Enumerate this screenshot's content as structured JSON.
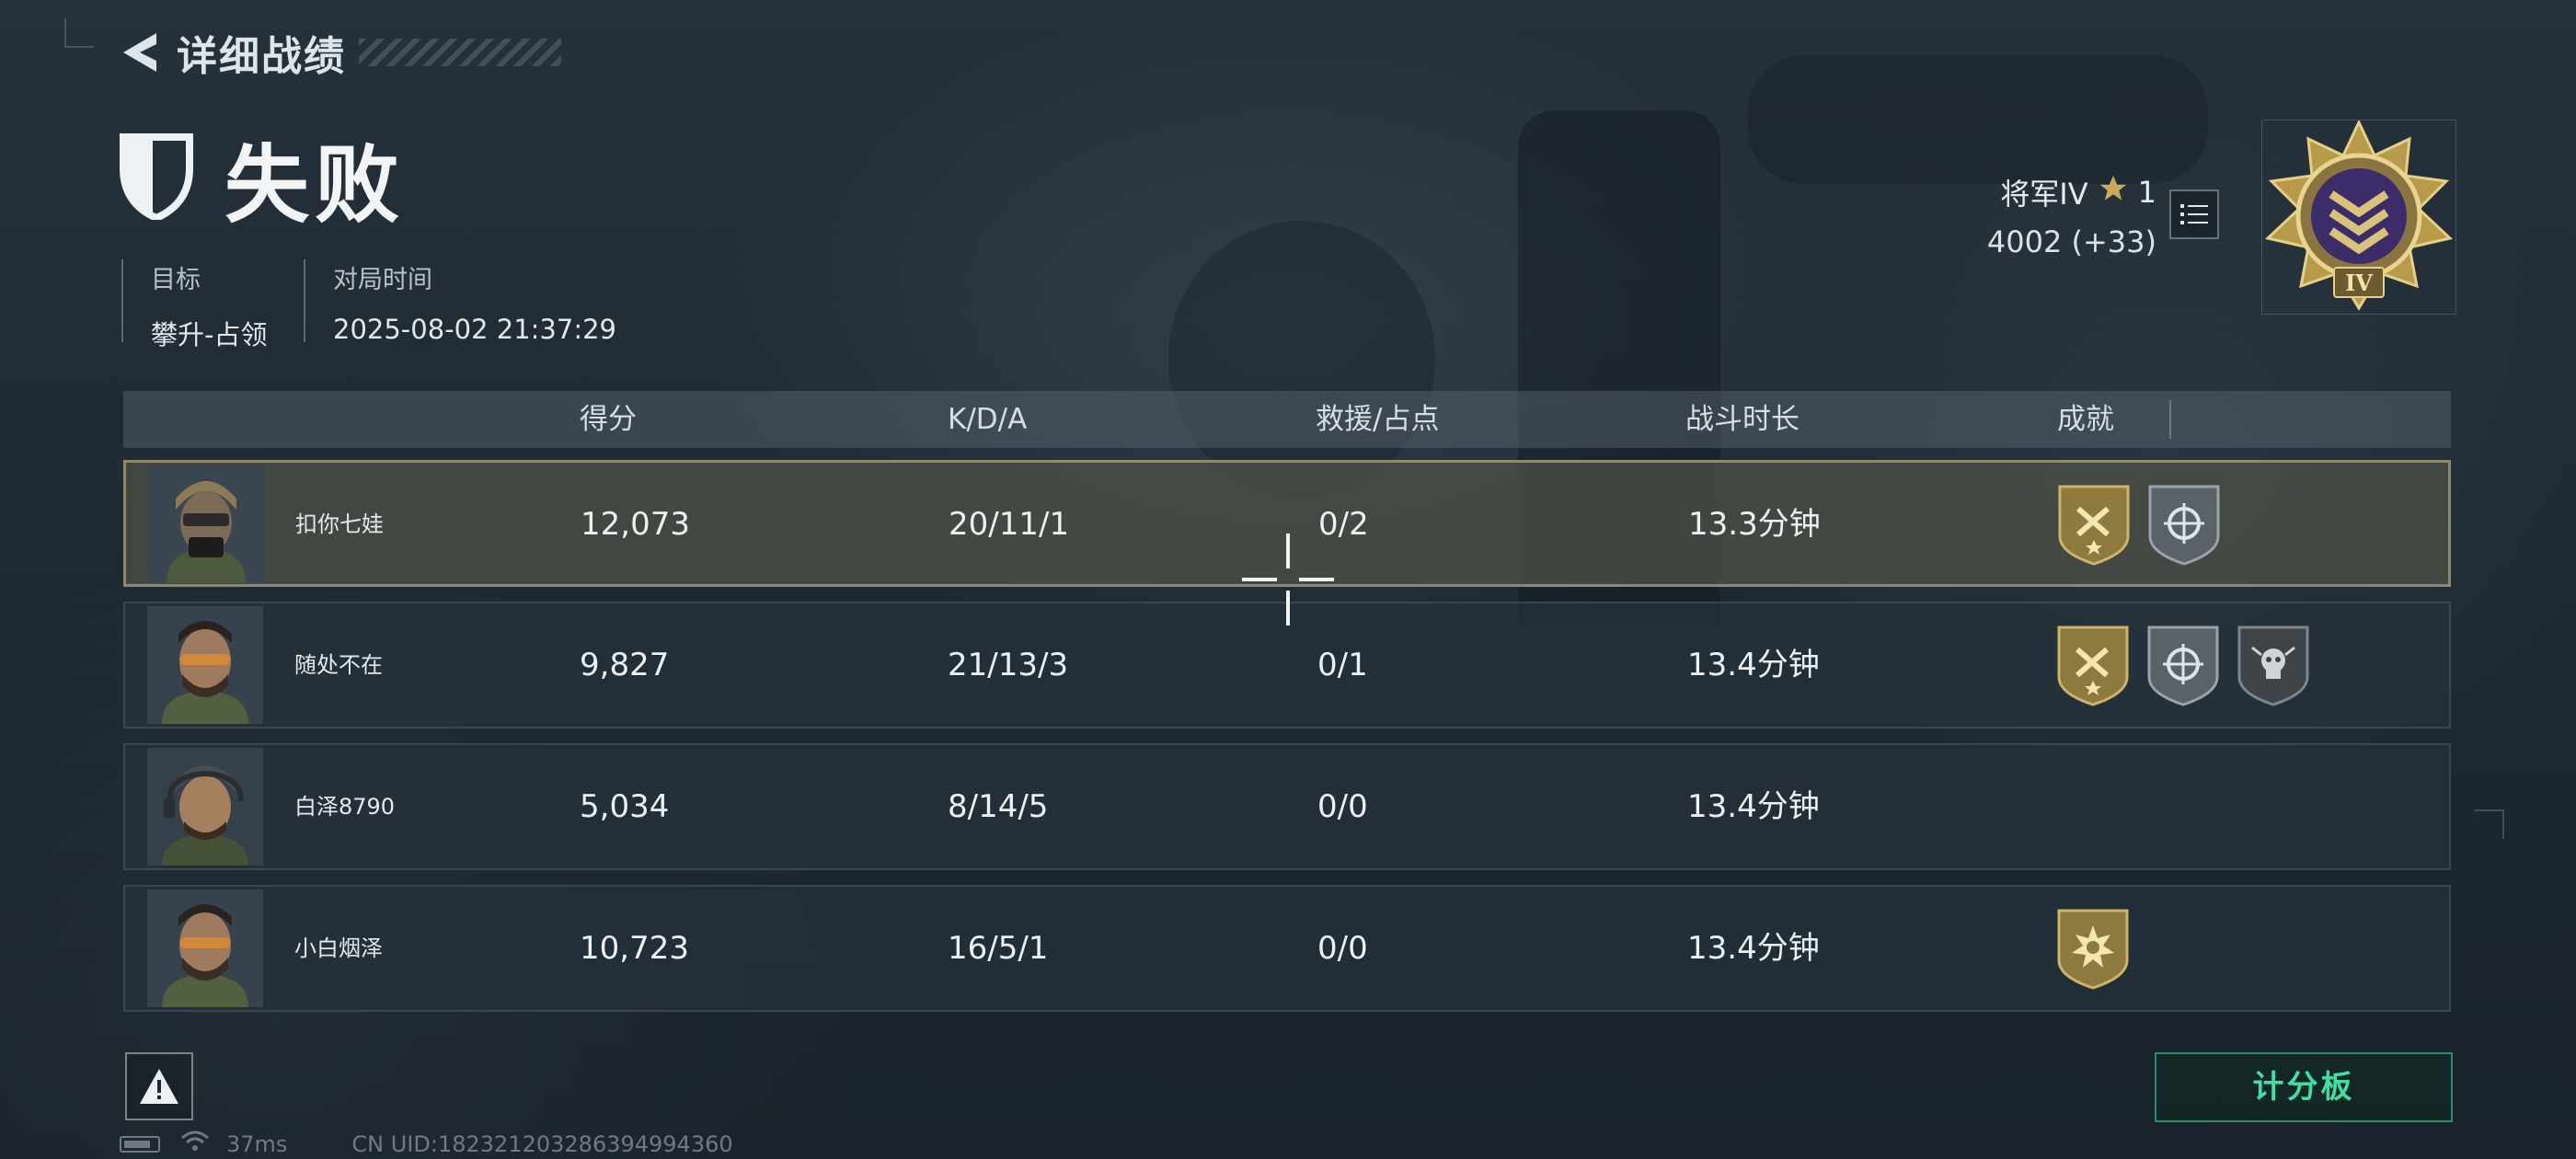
{
  "header": {
    "back_title": "详细战绩",
    "result": "失败"
  },
  "info": {
    "objective_label": "目标",
    "objective_value": "攀升-占领",
    "time_label": "对局时间",
    "time_value": "2025-08-02 21:37:29"
  },
  "rank": {
    "name": "将军IV",
    "stars": "1",
    "points": "4002 (+33)",
    "badge_numeral": "IV"
  },
  "table": {
    "headers": {
      "score": "得分",
      "kda": "K/D/A",
      "rescue": "救援/占点",
      "duration": "战斗时长",
      "achievements": "成就"
    },
    "rows": [
      {
        "name": "扣你七娃",
        "score": "12,073",
        "kda": "20/11/1",
        "rescue": "0/2",
        "duration": "13.3分钟",
        "badges": [
          "hammer-badge",
          "crosshair-badge"
        ]
      },
      {
        "name": "随处不在",
        "score": "9,827",
        "kda": "21/13/3",
        "rescue": "0/1",
        "duration": "13.4分钟",
        "badges": [
          "hammer-badge",
          "crosshair-badge",
          "skull-badge"
        ]
      },
      {
        "name": "白泽8790",
        "score": "5,034",
        "kda": "8/14/5",
        "rescue": "0/0",
        "duration": "13.4分钟",
        "badges": []
      },
      {
        "name": "小白烟泽",
        "score": "10,723",
        "kda": "16/5/1",
        "rescue": "0/0",
        "duration": "13.4分钟",
        "badges": [
          "burst-badge"
        ]
      }
    ]
  },
  "footer": {
    "scoreboard_label": "计分板",
    "ping": "37ms",
    "uid": "CN UID:182321203286394994360"
  },
  "colors": {
    "accent_green": "#3fe0a3",
    "gold": "#b79a4a",
    "highlight_border": "#8d8a6e"
  }
}
